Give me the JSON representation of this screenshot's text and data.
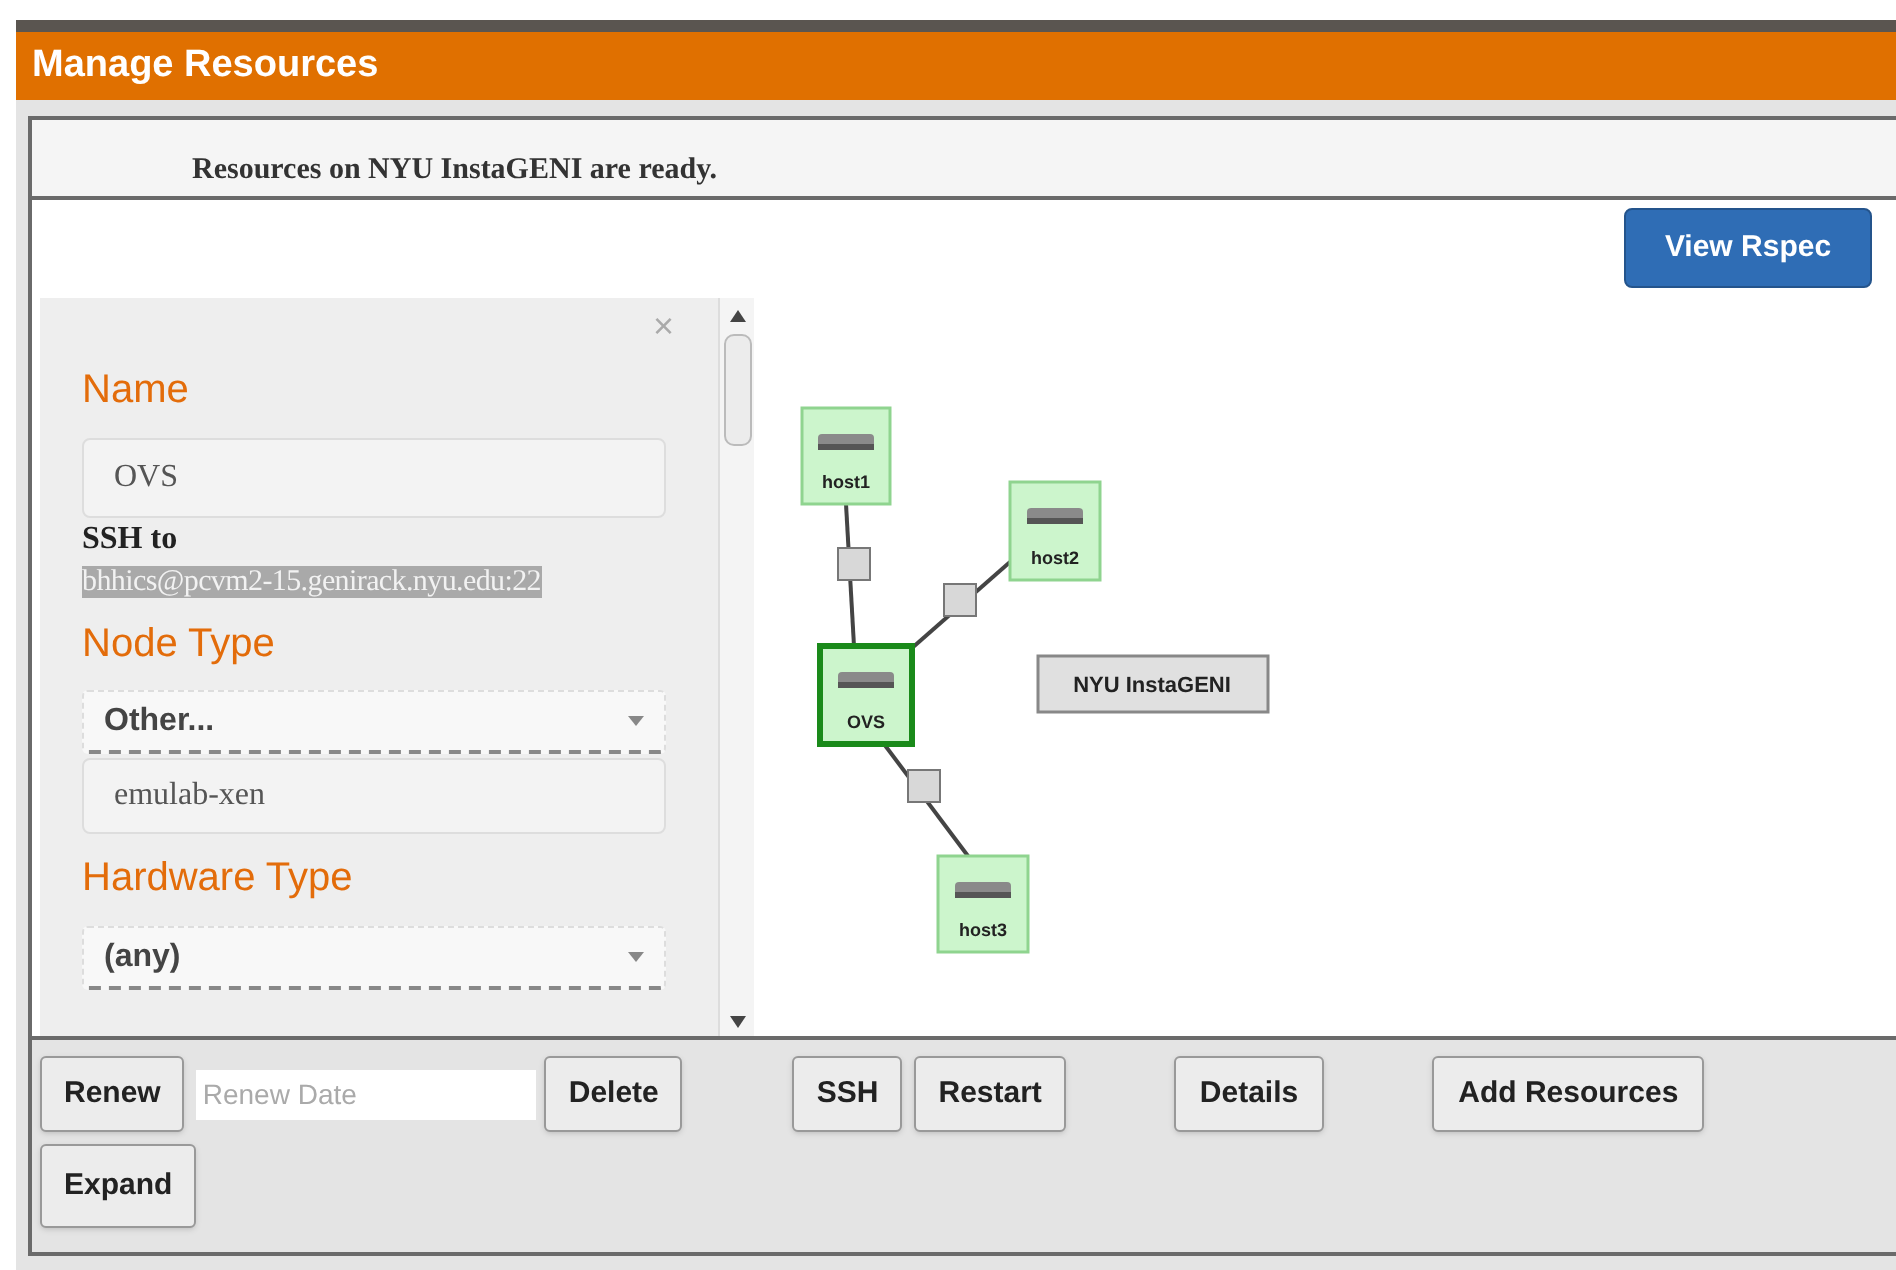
{
  "window": {
    "title": "Manage Resources"
  },
  "message": "Resources on NYU InstaGENI are ready.",
  "view_rspec_button": "View Rspec",
  "details_panel": {
    "close": "×",
    "name_label": "Name",
    "name_value": "OVS",
    "ssh_label": "SSH to",
    "ssh_value": "bhhics@pcvm2-15.genirack.nyu.edu:22",
    "ssh_value_selected": true,
    "node_type_label": "Node Type",
    "node_type_select": "Other...",
    "node_type_value": "emulab-xen",
    "hardware_type_label": "Hardware Type",
    "hardware_type_select": "(any)"
  },
  "topology": {
    "site": "NYU InstaGENI",
    "nodes": [
      {
        "name": "host1",
        "selected": false
      },
      {
        "name": "host2",
        "selected": false
      },
      {
        "name": "OVS",
        "selected": true
      },
      {
        "name": "host3",
        "selected": false
      }
    ]
  },
  "toolbar": {
    "renew": "Renew",
    "renew_date_placeholder": "Renew Date",
    "delete": "Delete",
    "ssh": "SSH",
    "restart": "Restart",
    "details": "Details",
    "add_resources": "Add Resources",
    "expand": "Expand"
  }
}
